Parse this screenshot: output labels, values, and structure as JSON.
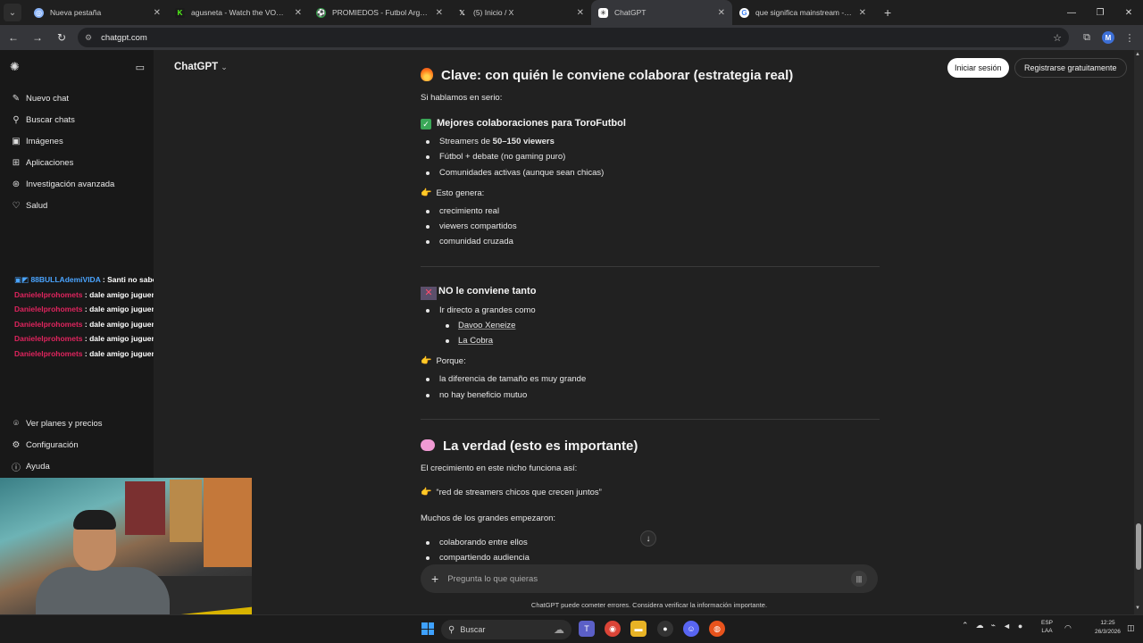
{
  "browser": {
    "tabs": [
      {
        "title": "Nueva pestaña",
        "icon": "globe-icon",
        "color": "#8ab4f8"
      },
      {
        "title": "agusneta - Watch the VOD on K",
        "icon": "kick-icon",
        "color": "#53fc18"
      },
      {
        "title": "PROMIEDOS - Futbol Argentino",
        "icon": "promiedos-icon",
        "color": "#2e9e45"
      },
      {
        "title": "(5) Inicio / X",
        "icon": "x-icon",
        "color": "#ffffff"
      },
      {
        "title": "ChatGPT",
        "icon": "chatgpt-icon",
        "color": "#ffffff"
      },
      {
        "title": "que significa mainstream - Bus",
        "icon": "google-icon",
        "color": "#4285f4"
      }
    ],
    "url": "chatgpt.com",
    "profile_initial": "M"
  },
  "sidebar": {
    "items": [
      {
        "label": "Nuevo chat",
        "icon": "new-chat-icon"
      },
      {
        "label": "Buscar chats",
        "icon": "search-icon"
      },
      {
        "label": "Imágenes",
        "icon": "images-icon"
      },
      {
        "label": "Aplicaciones",
        "icon": "apps-icon"
      },
      {
        "label": "Investigación avanzada",
        "icon": "research-icon"
      },
      {
        "label": "Salud",
        "icon": "heart-icon"
      }
    ],
    "bottom_items": [
      {
        "label": "Ver planes y precios",
        "icon": "plans-icon"
      },
      {
        "label": "Configuración",
        "icon": "gear-icon"
      },
      {
        "label": "Ayuda",
        "icon": "help-icon"
      }
    ]
  },
  "stream_chat": [
    {
      "user": "88BULLAdemiVIDA",
      "message": ": Santi no sabe de fútbol toro",
      "color": "#4aa4ff"
    },
    {
      "user": "Danielelprohomets",
      "message": ": dale amigo juguemos",
      "color": "#e0245e"
    },
    {
      "user": "Danielelprohomets",
      "message": ": dale amigo juguemos",
      "color": "#e0245e"
    },
    {
      "user": "Danielelprohomets",
      "message": ": dale amigo juguemos",
      "color": "#e0245e"
    },
    {
      "user": "Danielelprohomets",
      "message": ": dale amigo juguemos",
      "color": "#e0245e"
    },
    {
      "user": "Danielelprohomets",
      "message": ": dale amigo juguemos",
      "color": "#e0245e"
    }
  ],
  "header": {
    "model": "ChatGPT",
    "login": "Iniciar sesión",
    "signup": "Registrarse gratuitamente"
  },
  "content": {
    "h1": "Clave: con quién le conviene colaborar (estrategia real)",
    "intro": "Si hablamos en serio:",
    "best_title": "Mejores colaboraciones para ToroFutbol",
    "best_items": [
      {
        "pre": "Streamers de ",
        "bold": "50–150 viewers"
      },
      {
        "pre": "Fútbol + debate (no gaming puro)",
        "bold": ""
      },
      {
        "pre": "Comunidades activas (aunque sean chicas)",
        "bold": ""
      }
    ],
    "genera": "Esto genera:",
    "genera_items": [
      "crecimiento real",
      "viewers compartidos",
      "comunidad cruzada"
    ],
    "no_title": "NO le conviene tanto",
    "no_item": "Ir directo a grandes como",
    "no_sub": [
      "Davoo Xeneize",
      "La Cobra"
    ],
    "porque": "Porque:",
    "porque_items": [
      "la diferencia de tamaño es muy grande",
      "no hay beneficio mutuo"
    ],
    "h2": "La verdad (esto es importante)",
    "truth_intro": "El crecimiento en este nicho funciona así:",
    "truth_quote": "“red de streamers chicos que crecen juntos”",
    "muchos": "Muchos de los grandes empezaron:",
    "muchos_items": [
      "colaborando entre ellos",
      "compartiendo audiencia"
    ]
  },
  "composer": {
    "placeholder": "Pregunta lo que quieras",
    "disclaimer": "ChatGPT puede cometer errores. Considera verificar la información importante."
  },
  "taskbar": {
    "search": "Buscar",
    "lang_top": "ESP",
    "lang_bottom": "LAA",
    "time": "12:25",
    "date": "26/3/2026"
  }
}
